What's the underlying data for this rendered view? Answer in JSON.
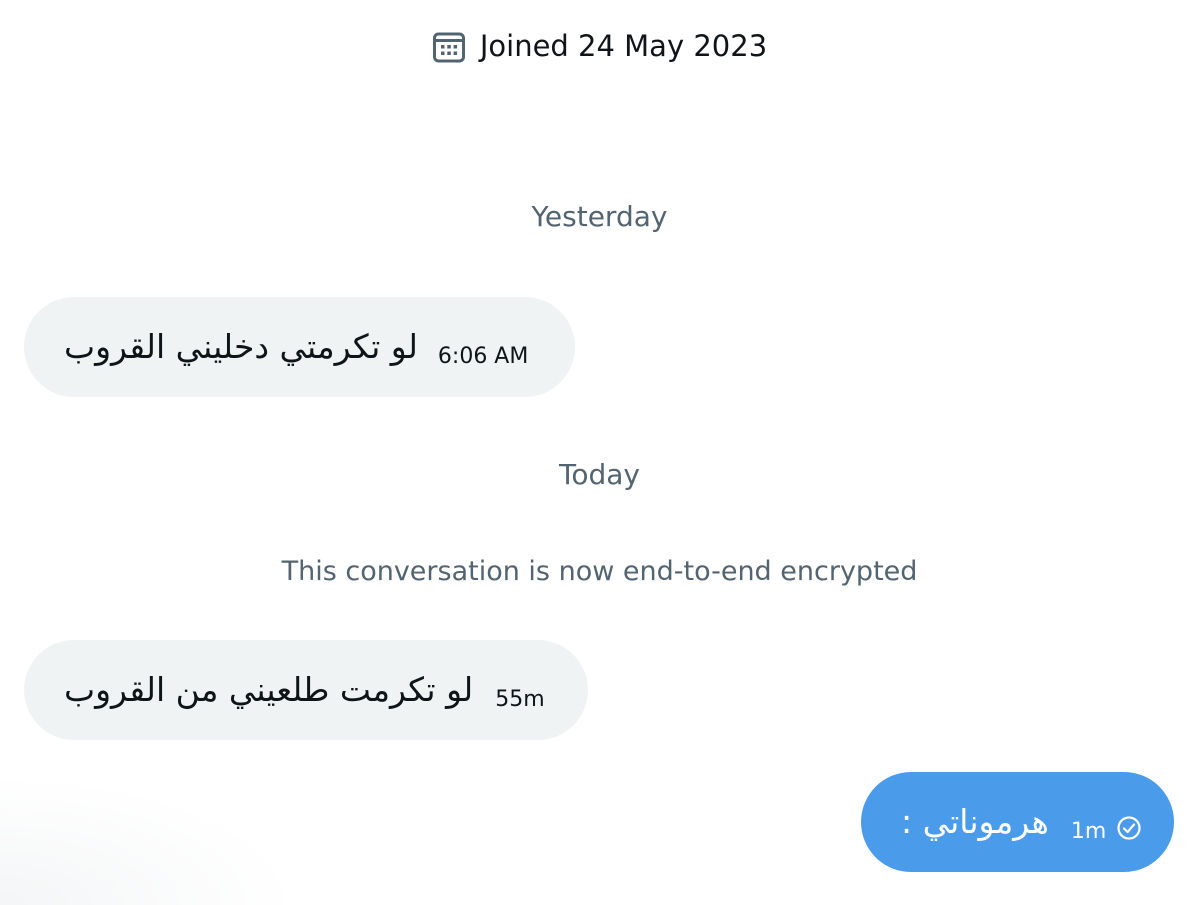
{
  "profile": {
    "joined_text": "Joined 24 May 2023",
    "calendar_icon": "calendar-icon"
  },
  "dividers": {
    "yesterday": "Yesterday",
    "today": "Today"
  },
  "system": {
    "encrypted_notice": "This conversation is now end-to-end encrypted"
  },
  "messages": [
    {
      "direction": "received",
      "text": "لو تكرمتي دخليني القروب",
      "time": "6:06 AM"
    },
    {
      "direction": "received",
      "text": "لو تكرمت طلعيني من القروب",
      "time": "55m"
    },
    {
      "direction": "sent",
      "text": "هرموناتي :",
      "time": "1m",
      "status_icon": "check-circle-icon"
    }
  ],
  "colors": {
    "received_bubble": "#eff3f4",
    "sent_bubble": "#4a9be9",
    "muted_text": "#536471",
    "primary_text": "#0f1419"
  }
}
